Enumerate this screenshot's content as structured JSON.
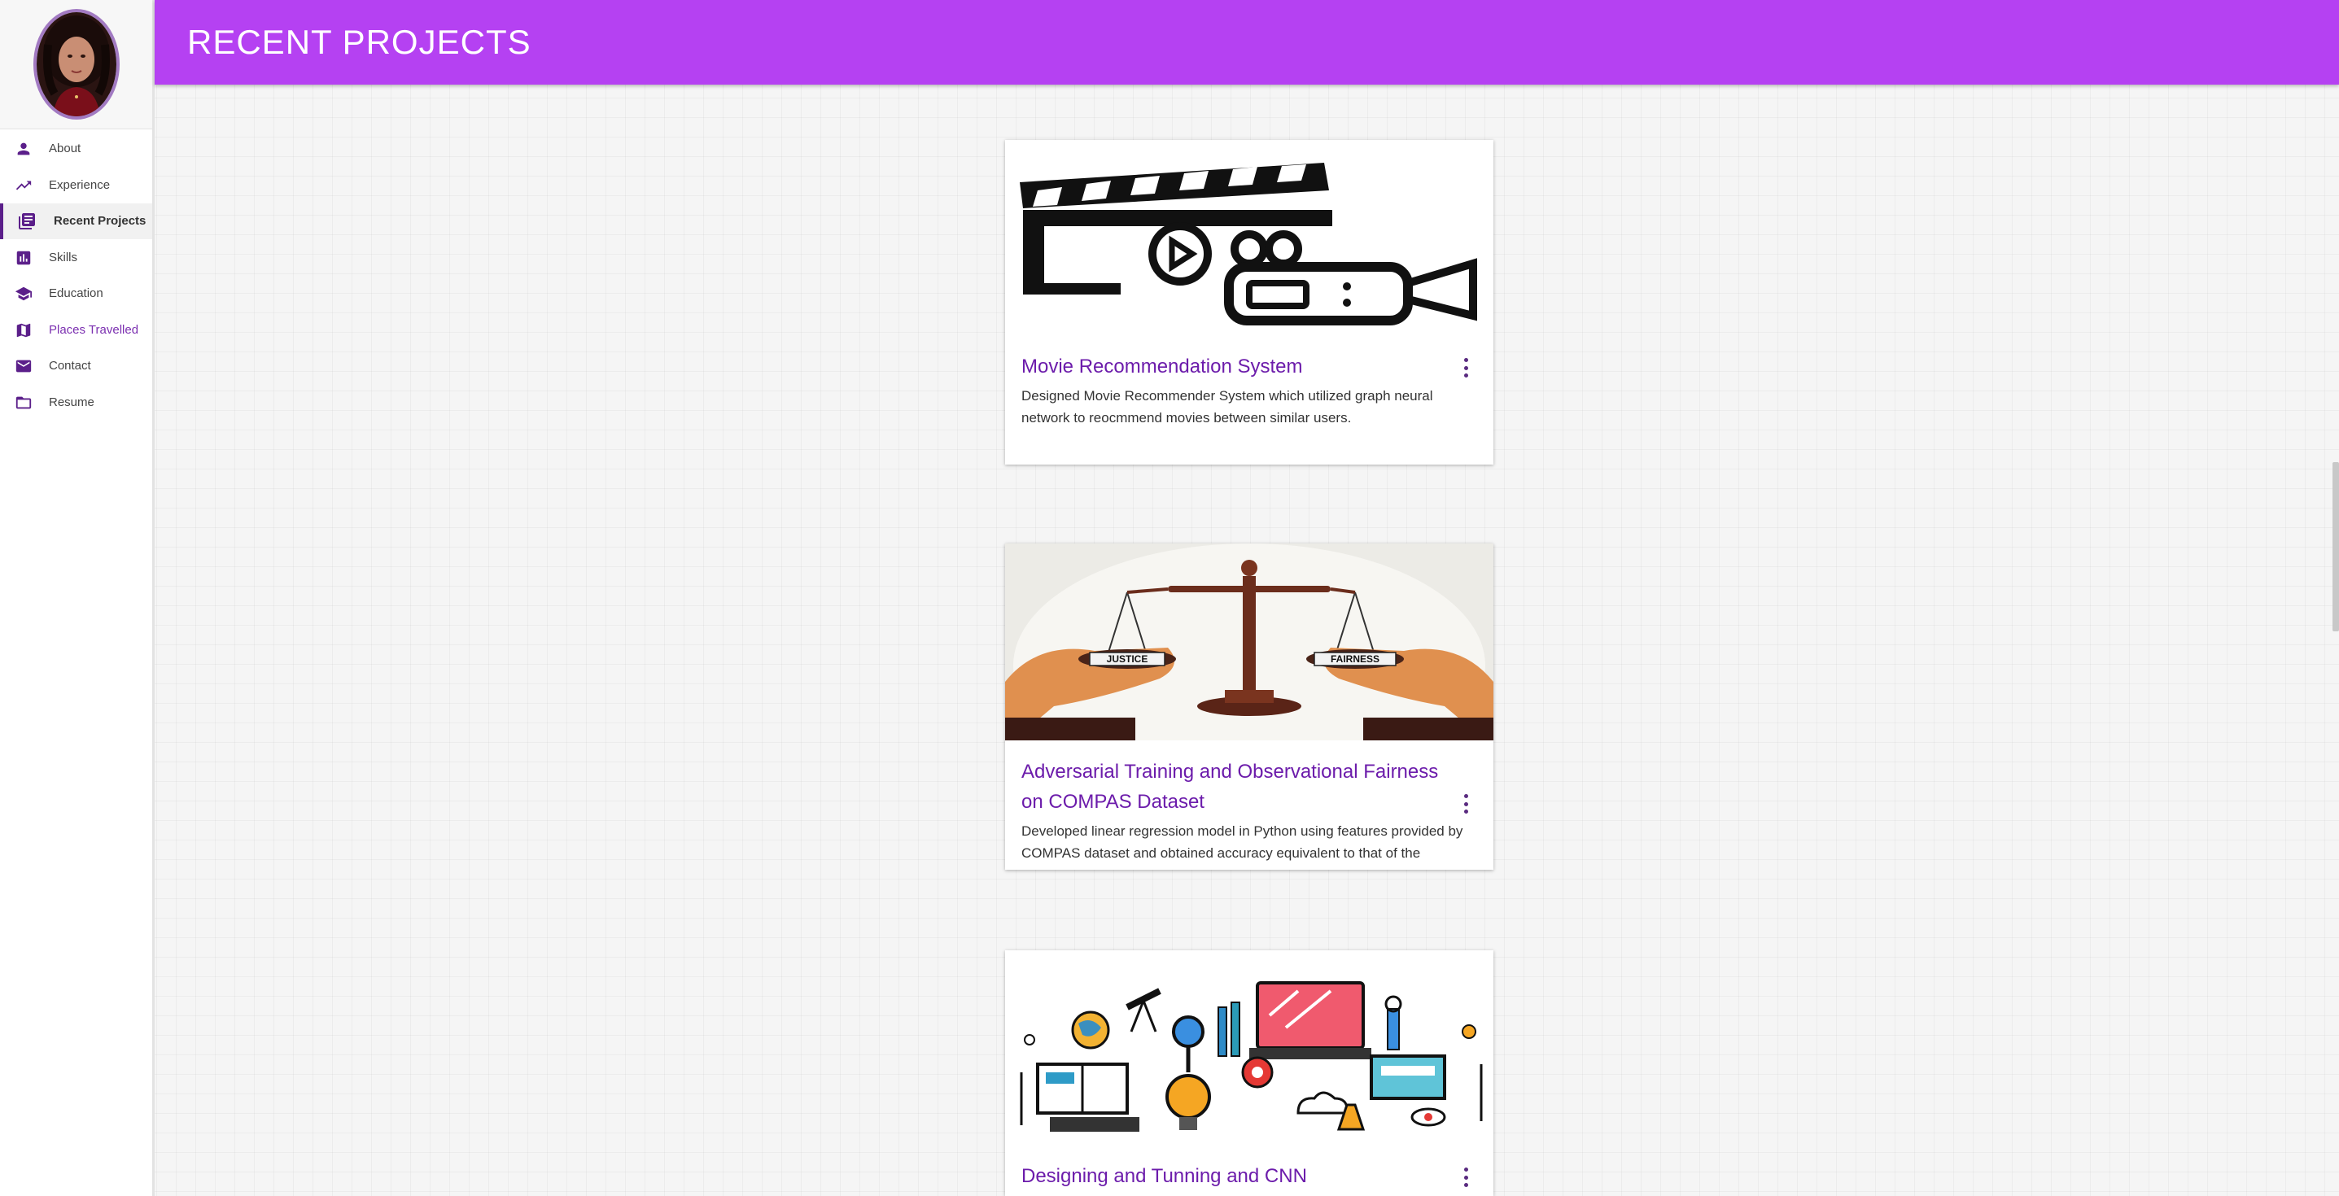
{
  "header": {
    "title": "RECENT PROJECTS"
  },
  "sidebar": {
    "items": [
      {
        "label": "About",
        "icon": "person-icon"
      },
      {
        "label": "Experience",
        "icon": "trending-up-icon"
      },
      {
        "label": "Recent Projects",
        "icon": "library-books-icon",
        "active": true
      },
      {
        "label": "Skills",
        "icon": "bar-chart-icon"
      },
      {
        "label": "Education",
        "icon": "school-icon"
      },
      {
        "label": "Places Travelled",
        "icon": "map-icon"
      },
      {
        "label": "Contact",
        "icon": "mail-icon"
      },
      {
        "label": "Resume",
        "icon": "folder-icon"
      }
    ]
  },
  "projects": [
    {
      "title": "Movie Recommendation System",
      "description": "Designed Movie Recommender System which utilized graph neural network to reocmmend movies between similar users.",
      "image": "clapperboard-camera-icon"
    },
    {
      "title": "Adversarial Training and Observational Fairness on COMPAS Dataset",
      "description": "Developed linear regression model in Python using features provided by COMPAS dataset and obtained accuracy equivalent to that of the",
      "image": "justice-scales-illustration",
      "scale_labels": [
        "JUSTICE",
        "FAIRNESS"
      ]
    },
    {
      "title": "Designing and Tunning and CNN",
      "description": "",
      "image": "science-tools-collage"
    }
  ],
  "colors": {
    "header": "#b541f2",
    "accent": "#6c1cab",
    "nav_icon": "#5b1f8a"
  }
}
